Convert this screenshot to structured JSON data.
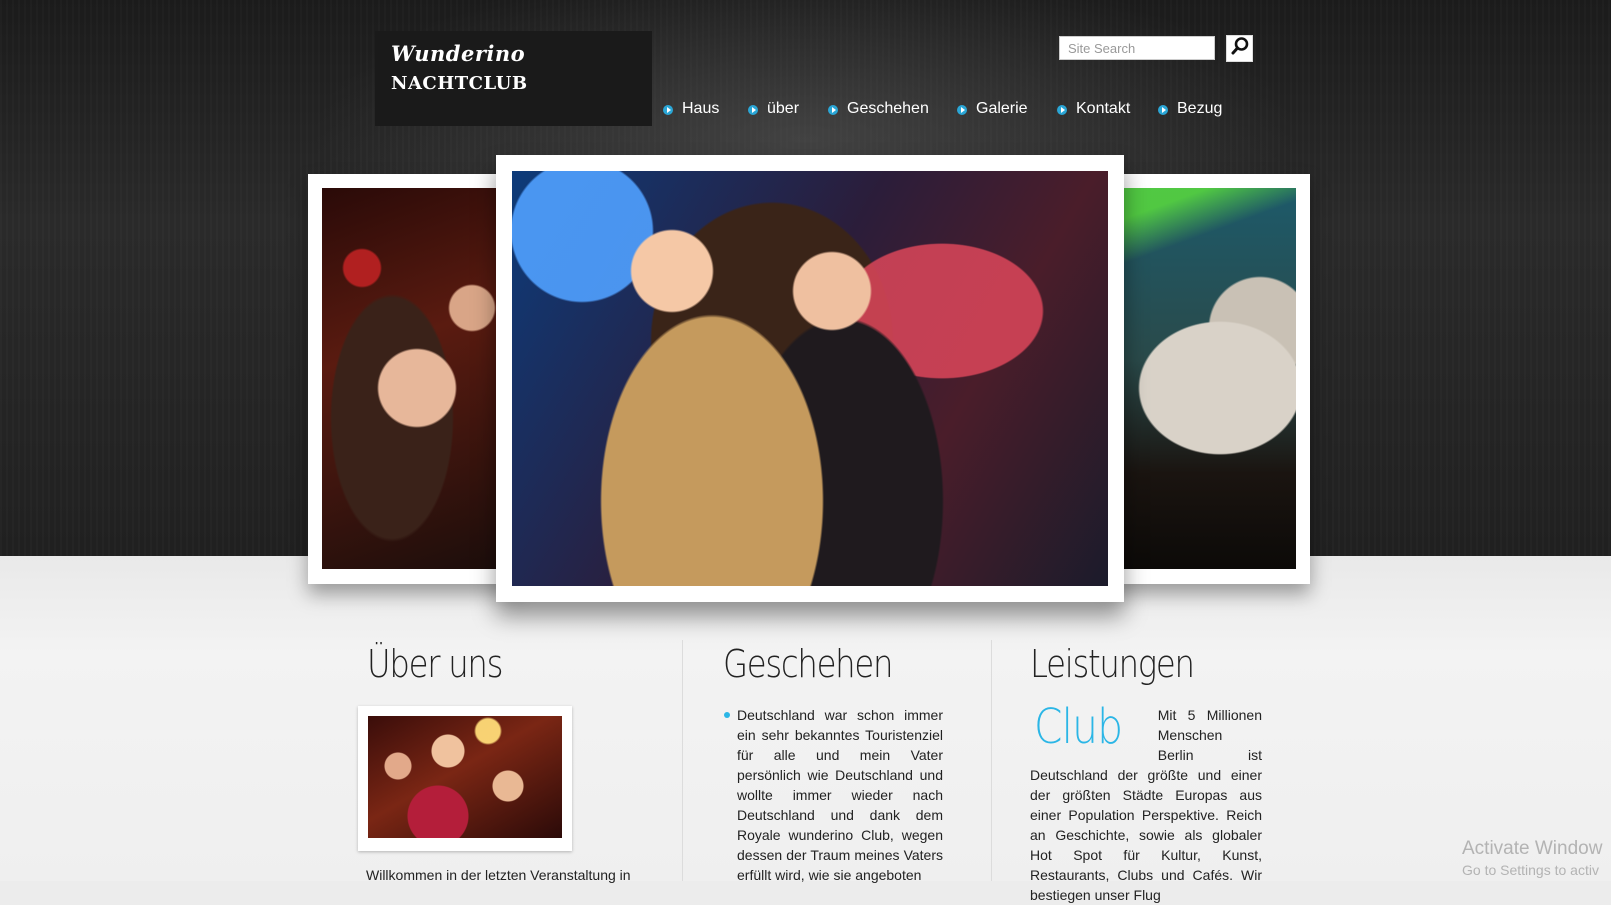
{
  "header": {
    "logo_line1": "Wunderino",
    "logo_line2": "NACHTCLUB",
    "search_placeholder": "Site Search"
  },
  "nav": {
    "items": [
      {
        "label": "Haus"
      },
      {
        "label": "über"
      },
      {
        "label": "Geschehen"
      },
      {
        "label": "Galerie"
      },
      {
        "label": "Kontakt"
      },
      {
        "label": "Bezug"
      }
    ]
  },
  "columns": {
    "about": {
      "title": "Über uns",
      "text": "Willkommen in der letzten Veranstaltung in"
    },
    "events": {
      "title": "Geschehen",
      "text": "Deutschland war schon immer ein sehr bekanntes Touristenziel für alle und mein Vater persönlich wie Deutschland und wollte immer wieder nach Deutschland und dank dem Royale wunderino Club, wegen dessen der Traum meines Vaters erfüllt wird, wie sie angeboten"
    },
    "services": {
      "title": "Leistungen",
      "club_word": "Club",
      "text": "Mit 5 Millionen Menschen Berlin ist Deutschland der größte und einer der größten Städte Europas aus einer Population Perspektive. Reich an Geschichte, sowie als globaler Hot Spot für Kultur, Kunst, Restaurants, Clubs und Cafés. Wir bestiegen unser Flug"
    }
  },
  "system": {
    "watermark_line1": "Activate Window",
    "watermark_line2": "Go to Settings to activ"
  },
  "colors": {
    "accent": "#2bb6e6",
    "header_bg": "#1f1f1f",
    "content_bg": "#ececec"
  }
}
